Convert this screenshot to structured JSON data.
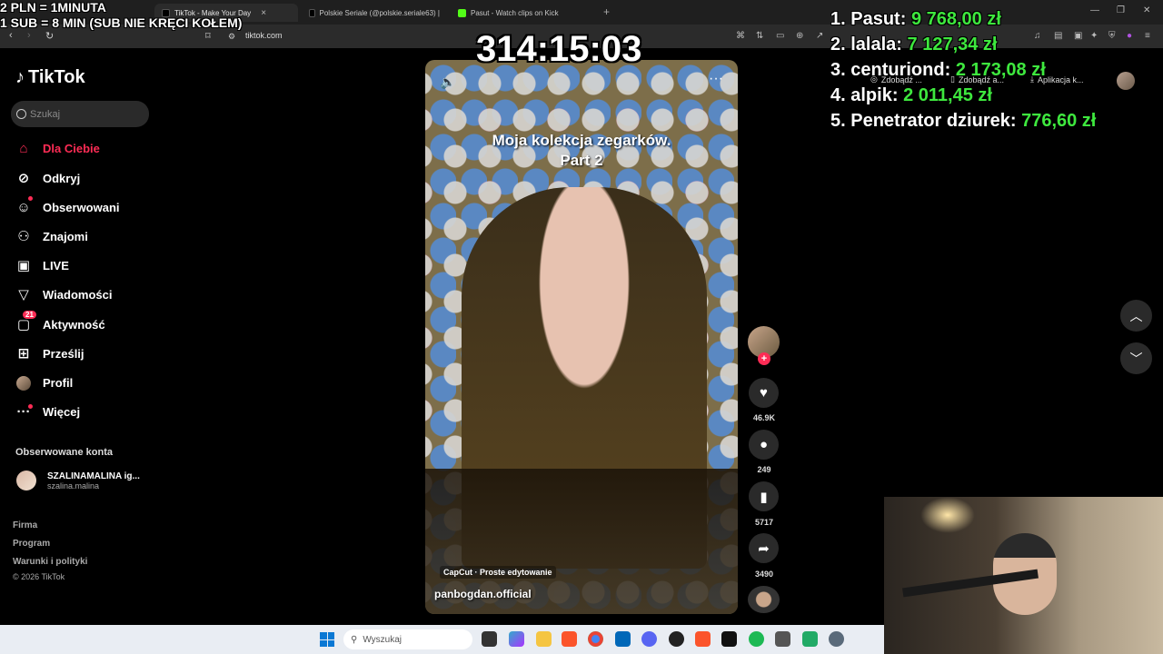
{
  "browser": {
    "tabs": [
      {
        "label": "TikTok - Make Your Day",
        "active": true
      },
      {
        "label": "Polskie Seriale (@polskie.seriale63) |",
        "active": false
      },
      {
        "label": "Pasut - Watch clips on Kick",
        "active": false
      }
    ],
    "url": "tiktok.com",
    "extensions": [
      "Zdobądź ...",
      "Zdobądź a...",
      "Aplikacja k..."
    ]
  },
  "overlay": {
    "line1": "2 PLN = 1MINUTA",
    "line2": "1 SUB = 8 MIN (SUB NIE KRĘCI KOŁEM)",
    "timer": "314:15:03",
    "leaderboard": [
      {
        "rank": "1.",
        "name": "Pasut:",
        "amount": "9 768,00 zł"
      },
      {
        "rank": "2.",
        "name": "lalala:",
        "amount": "7 127,34 zł"
      },
      {
        "rank": "3.",
        "name": "centuriond:",
        "amount": "2 173,08 zł"
      },
      {
        "rank": "4.",
        "name": "alpik:",
        "amount": "2 011,45 zł"
      },
      {
        "rank": "5.",
        "name": "Penetrator dziurek:",
        "amount": "776,60 zł"
      }
    ]
  },
  "tiktok": {
    "logo": "TikTok",
    "search_placeholder": "Szukaj",
    "menu": [
      {
        "label": "Dla Ciebie",
        "icon": "home-icon"
      },
      {
        "label": "Odkryj",
        "icon": "compass-icon"
      },
      {
        "label": "Obserwowani",
        "icon": "following-icon"
      },
      {
        "label": "Znajomi",
        "icon": "friends-icon"
      },
      {
        "label": "LIVE",
        "icon": "live-icon"
      },
      {
        "label": "Wiadomości",
        "icon": "messages-icon"
      },
      {
        "label": "Aktywność",
        "icon": "activity-icon",
        "badge": "21"
      },
      {
        "label": "Prześlij",
        "icon": "upload-icon"
      },
      {
        "label": "Profil",
        "icon": "profile-icon"
      },
      {
        "label": "Więcej",
        "icon": "more-icon"
      }
    ],
    "followed_title": "Obserwowane konta",
    "followed": {
      "name": "SZALINAMALINA ig...",
      "handle": "szalina.malina"
    },
    "footer": [
      "Firma",
      "Program",
      "Warunki i polityki"
    ],
    "copyright": "© 2026 TikTok"
  },
  "video": {
    "caption_line1": "Moja kolekcja zegarków.",
    "caption_line2": "Part 2",
    "capcut": "CapCut · Proste edytowanie",
    "author": "panbogdan.official",
    "likes": "46.9K",
    "comments": "249",
    "saves": "5717",
    "shares": "3490"
  },
  "taskbar": {
    "search_placeholder": "Wyszukaj"
  }
}
